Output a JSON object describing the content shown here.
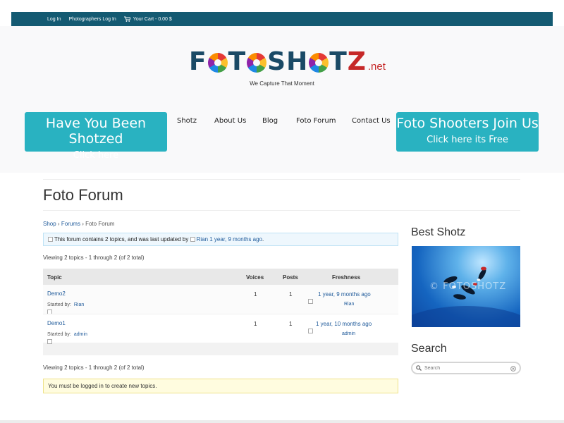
{
  "topbar": {
    "login": "Log In",
    "photographers_login": "Photographers Log In",
    "cart": "Your Cart - 0.00 $"
  },
  "logo": {
    "part1": "F",
    "part2": "T",
    "part3": "SH",
    "part4": "T",
    "part5": "Z",
    "net": ".net",
    "tagline": "We Capture That Moment"
  },
  "cta_left": {
    "line1": "Have You Been Shotzed",
    "line2": "Click here"
  },
  "cta_right": {
    "line1": "Foto Shooters Join Us",
    "line2": "Click here its Free"
  },
  "nav": [
    "Shotz",
    "About Us",
    "Blog",
    "Foto Forum",
    "Contact Us"
  ],
  "page_title": "Foto Forum",
  "breadcrumb": {
    "shop": "Shop",
    "sep": "›",
    "forums": "Forums",
    "current": "Foto Forum"
  },
  "forum_info": {
    "text": "This forum contains 2 topics, and was last updated by",
    "author": "Rian",
    "when": "1 year, 9 months ago",
    "end": "."
  },
  "viewing": "Viewing 2 topics - 1 through 2 (of 2 total)",
  "table": {
    "headers": {
      "topic": "Topic",
      "voices": "Voices",
      "posts": "Posts",
      "freshness": "Freshness"
    },
    "rows": [
      {
        "title": "Demo2",
        "started_by_label": "Started by:",
        "author": "Rian",
        "voices": "1",
        "posts": "1",
        "freshness": "1 year, 9 months ago",
        "fresh_author": "Rian"
      },
      {
        "title": "Demo1",
        "started_by_label": "Started by:",
        "author": "admin",
        "voices": "1",
        "posts": "1",
        "freshness": "1 year, 10 months ago",
        "fresh_author": "admin"
      }
    ]
  },
  "login_notice": "You must be logged in to create new topics.",
  "sidebar": {
    "best_shotz_title": "Best Shotz",
    "watermark": "© FOTOSHOTZ",
    "search_title": "Search",
    "search_placeholder": "Search"
  },
  "colors": {
    "topbar": "#145a72",
    "cta": "#29b2c1",
    "link": "#1f5a9a",
    "logo_blue": "#1a4a66",
    "logo_red": "#c62828"
  },
  "icons": [
    "cart-icon",
    "search-icon",
    "clear-icon",
    "avatar-placeholder-icon"
  ]
}
